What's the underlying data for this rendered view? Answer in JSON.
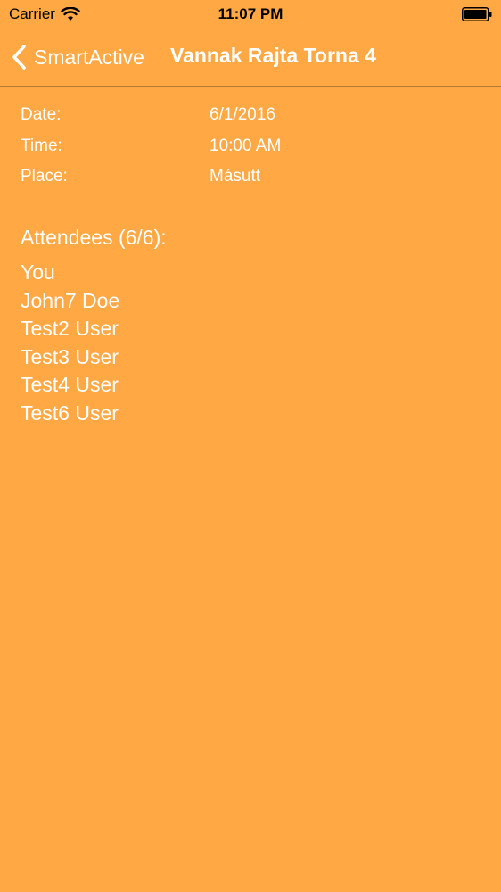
{
  "status_bar": {
    "carrier": "Carrier",
    "time": "11:07 PM"
  },
  "nav": {
    "back_label": "SmartActive",
    "title": "Vannak Rajta Torna 4"
  },
  "details": [
    {
      "label": "Date:",
      "value": "6/1/2016"
    },
    {
      "label": "Time:",
      "value": "10:00 AM"
    },
    {
      "label": "Place:",
      "value": "Másutt"
    }
  ],
  "attendees": {
    "header": "Attendees (6/6):",
    "names": [
      "You",
      "John7 Doe",
      "Test2 User",
      "Test3 User",
      "Test4 User",
      "Test6 User"
    ]
  },
  "colors": {
    "background": "#FFA844",
    "text": "#FFFFFF"
  },
  "icons": [
    "wifi-icon",
    "battery-icon",
    "back-chevron-icon"
  ]
}
